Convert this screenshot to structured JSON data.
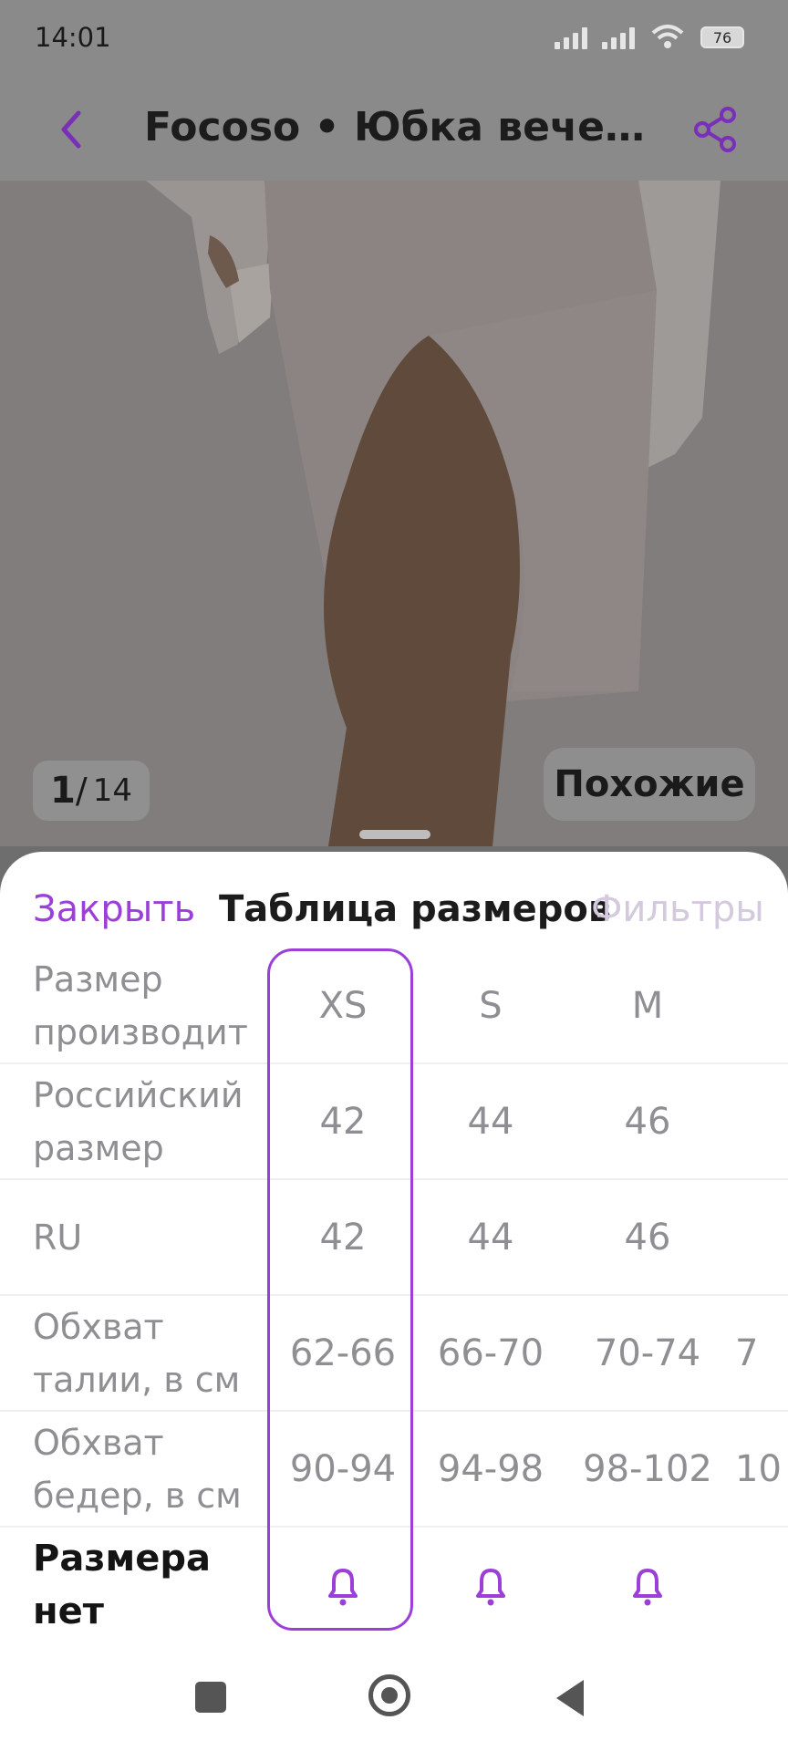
{
  "status_bar": {
    "time": "14:01",
    "battery": "76",
    "wifi_label": "6"
  },
  "app_bar": {
    "title": "Focoso • Юбка вечерн..."
  },
  "gallery": {
    "current": "1",
    "separator": "/",
    "total": "14",
    "similar_label": "Похожие"
  },
  "sheet": {
    "close_label": "Закрыть",
    "title": "Таблица размеров",
    "filters_label": "Фильтры"
  },
  "size_table": {
    "rows": [
      {
        "label": "Размер производит",
        "values": [
          "XS",
          "S",
          "M",
          ""
        ]
      },
      {
        "label": "Российский размер",
        "values": [
          "42",
          "44",
          "46",
          ""
        ]
      },
      {
        "label": "RU",
        "values": [
          "42",
          "44",
          "46",
          ""
        ]
      },
      {
        "label": "Обхват талии, в см",
        "values": [
          "62-66",
          "66-70",
          "70-74",
          "7"
        ]
      },
      {
        "label": "Обхват бедер, в см",
        "values": [
          "90-94",
          "94-98",
          "98-102",
          "10"
        ]
      }
    ],
    "notify_row_label": "Размера нет",
    "selected_size": "XS"
  },
  "colors": {
    "accent": "#9b3fd8",
    "muted_text": "#8e8e93",
    "filters_disabled": "#d4c9dd"
  }
}
